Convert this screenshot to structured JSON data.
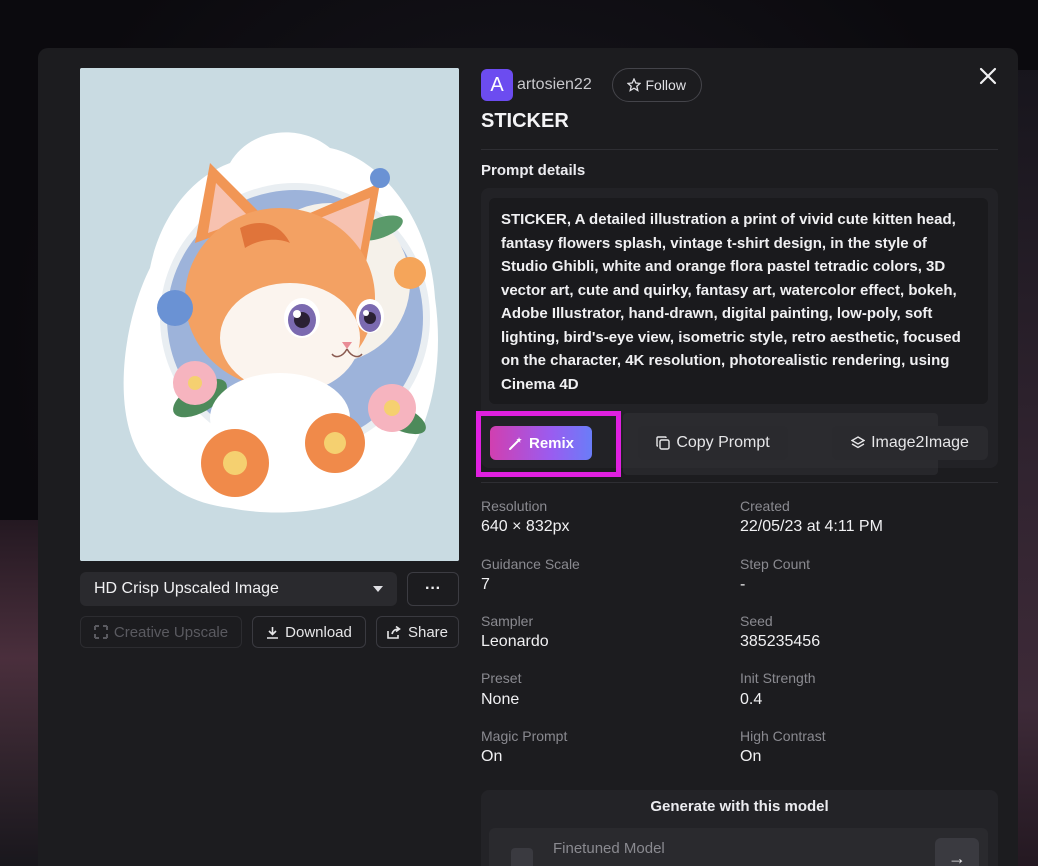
{
  "author": {
    "avatar_letter": "A",
    "name": "artosien22",
    "follow_label": "Follow"
  },
  "title": "STICKER",
  "prompt": {
    "section_label": "Prompt details",
    "text": "STICKER, A detailed illustration a print of vivid cute kitten head, fantasy flowers splash, vintage t-shirt design, in the style of Studio Ghibli, white and orange flora pastel tetradic colors, 3D vector art, cute and quirky, fantasy art, watercolor effect, bokeh, Adobe Illustrator, hand-drawn, digital painting, low-poly, soft lighting, bird's-eye view, isometric style, retro aesthetic, focused on the character, 4K resolution, photorealistic rendering, using Cinema 4D"
  },
  "actions": {
    "remix_label": "Remix",
    "copy_prompt_label": "Copy Prompt",
    "image2image_label": "Image2Image"
  },
  "image_panel": {
    "upscale_select_value": "HD Crisp Upscaled Image",
    "more_label": "···",
    "creative_upscale_label": "Creative Upscale",
    "download_label": "Download",
    "share_label": "Share"
  },
  "metadata": [
    {
      "label": "Resolution",
      "value": "640 × 832px"
    },
    {
      "label": "Created",
      "value": "22/05/23 at 4:11 PM"
    },
    {
      "label": "Guidance Scale",
      "value": "7"
    },
    {
      "label": "Step Count",
      "value": "-"
    },
    {
      "label": "Sampler",
      "value": "Leonardo"
    },
    {
      "label": "Seed",
      "value": "385235456"
    },
    {
      "label": "Preset",
      "value": "None"
    },
    {
      "label": "Init Strength",
      "value": "0.4"
    },
    {
      "label": "Magic Prompt",
      "value": "On"
    },
    {
      "label": "High Contrast",
      "value": "On"
    }
  ],
  "generate": {
    "title": "Generate with this model",
    "model_label": "Finetuned Model",
    "arrow": "→"
  },
  "colors": {
    "accent_gradient_start": "#d13fb0",
    "accent_gradient_end": "#6a7df8",
    "highlight": "#e020e0",
    "avatar": "#6c4cf0"
  }
}
